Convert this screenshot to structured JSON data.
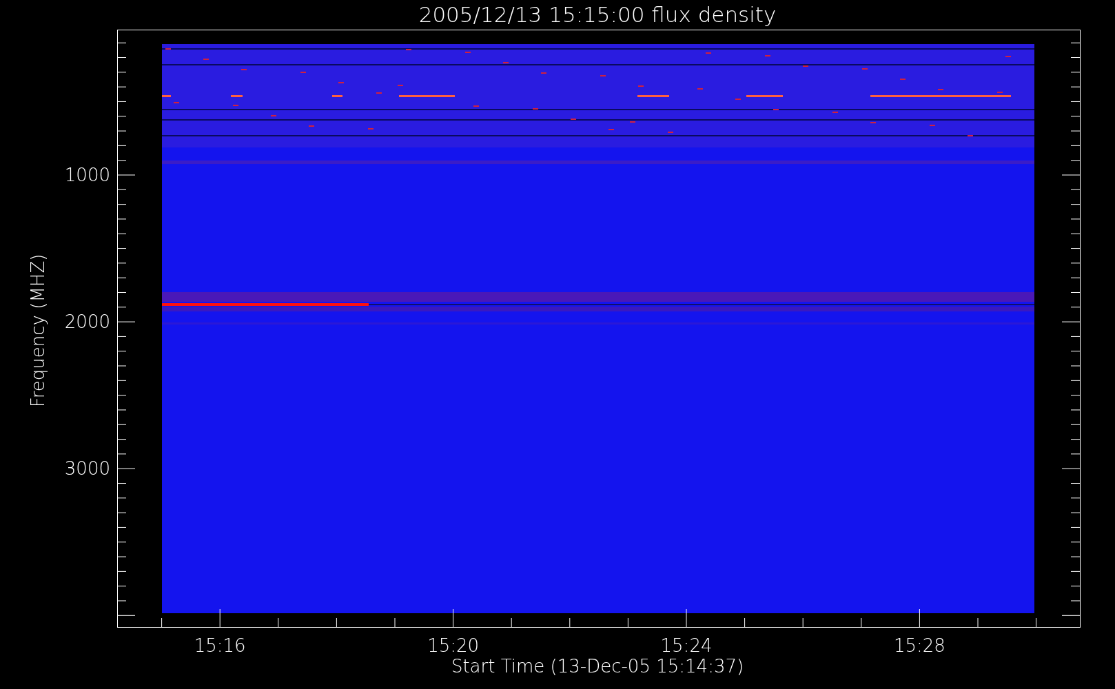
{
  "plot": {
    "title": "2005/12/13 15:15:00 flux density",
    "ylabel": "Frequency (MHZ)",
    "xlabel": "Start Time (13-Dec-05 15:14:37)",
    "xtick_labels": [
      "15:16",
      "15:20",
      "15:24",
      "15:28"
    ],
    "ytick_labels": [
      "1000",
      "2000",
      "3000"
    ]
  }
}
